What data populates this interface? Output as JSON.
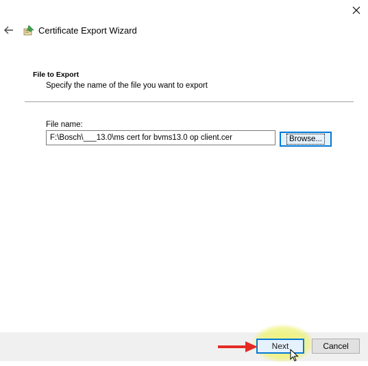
{
  "window": {
    "title": "Certificate Export Wizard",
    "close_icon": "close-icon",
    "back_icon": "back-arrow-icon",
    "wizard_icon": "certificate-icon"
  },
  "section": {
    "title": "File to Export",
    "description": "Specify the name of the file you want to export"
  },
  "form": {
    "file_name_label": "File name:",
    "file_name_value": "F:\\Bosch\\___13.0\\ms cert for bvms13.0 op client.cer",
    "browse_label": "Browse..."
  },
  "footer": {
    "next_label": "Next",
    "cancel_label": "Cancel"
  },
  "colors": {
    "accent": "#0078d7",
    "annotation_arrow": "#e52a24",
    "click_highlight": "#eef26e"
  }
}
